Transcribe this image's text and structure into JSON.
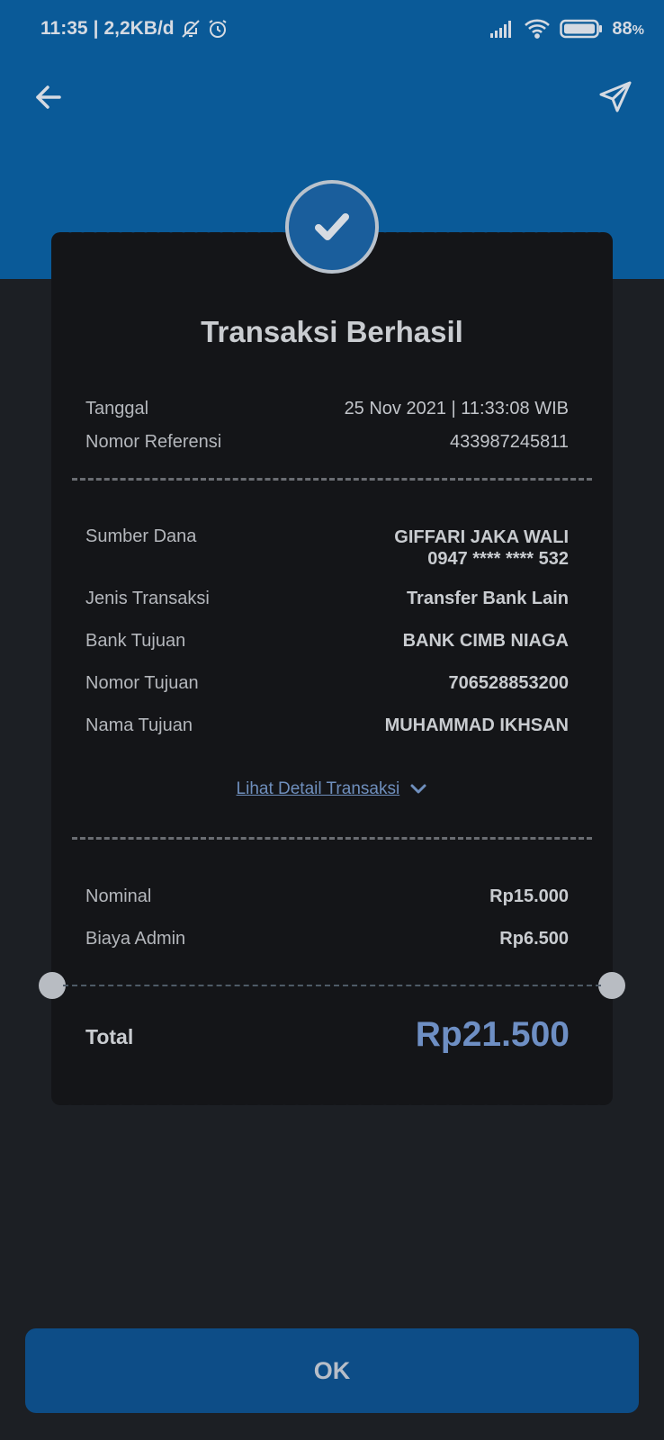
{
  "status": {
    "time": "11:35",
    "speed": "2,2KB/d",
    "battery": "88",
    "battery_unit": "%"
  },
  "icons": {
    "back": "arrow-left-icon",
    "share": "send-icon",
    "check": "check-icon"
  },
  "receipt": {
    "title": "Transaksi Berhasil",
    "tanggal_label": "Tanggal",
    "tanggal_value": "25 Nov 2021 | 11:33:08 WIB",
    "ref_label": "Nomor Referensi",
    "ref_value": "433987245811",
    "sumber_label": "Sumber Dana",
    "sumber_name": "GIFFARI JAKA WALI",
    "sumber_account": "0947 **** **** 532",
    "jenis_label": "Jenis Transaksi",
    "jenis_value": "Transfer Bank Lain",
    "bank_label": "Bank Tujuan",
    "bank_value": "BANK CIMB NIAGA",
    "nomor_label": "Nomor Tujuan",
    "nomor_value": "706528853200",
    "nama_label": "Nama Tujuan",
    "nama_value": "MUHAMMAD IKHSAN",
    "detail_link": "Lihat Detail Transaksi",
    "nominal_label": "Nominal",
    "nominal_value": "Rp15.000",
    "admin_label": "Biaya Admin",
    "admin_value": "Rp6.500",
    "total_label": "Total",
    "total_value": "Rp21.500"
  },
  "ok_button": "OK",
  "colors": {
    "header_blue": "#0a5a98",
    "background": "#1c1f24",
    "card": "#141518",
    "accent_total": "#6e8fc4",
    "button": "#0d4d87"
  }
}
